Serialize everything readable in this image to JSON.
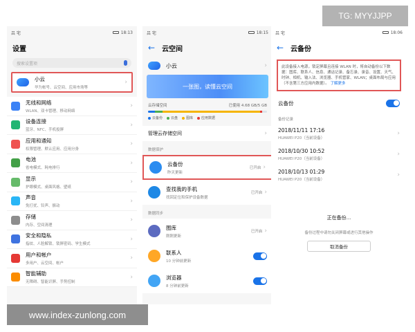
{
  "watermarks": {
    "top": "TG: MYYJJPP",
    "bottom": "www.index-zunlong.com"
  },
  "panel1": {
    "status": {
      "left": "吕 宅",
      "time": "18:13"
    },
    "title": "设置",
    "search_placeholder": "搜索设置项",
    "cloud_row": {
      "title": "小云",
      "subtitle": "华为帐号、云空间、应用市场等"
    },
    "items": [
      {
        "title": "无线和网络",
        "subtitle": "WLAN、双卡管理、移动网络",
        "color": "#3b82f6"
      },
      {
        "title": "设备连接",
        "subtitle": "蓝牙、NFC、手机投屏",
        "color": "#22b573"
      },
      {
        "title": "应用和通知",
        "subtitle": "权限管理、默认应用、应用分身",
        "color": "#ef5350"
      },
      {
        "title": "电池",
        "subtitle": "省电模式、耗电排行",
        "color": "#43a047"
      },
      {
        "title": "显示",
        "subtitle": "护眼模式、桌面风格、壁纸",
        "color": "#66bb6a"
      },
      {
        "title": "声音",
        "subtitle": "免打扰、铃声、振动",
        "color": "#29b6f6"
      },
      {
        "title": "存储",
        "subtitle": "内存、空间清理",
        "color": "#8d8d8d"
      },
      {
        "title": "安全和隐私",
        "subtitle": "指纹、人脸解锁、锁屏密码、学生模式",
        "color": "#3f73e0"
      },
      {
        "title": "用户和帐户",
        "subtitle": "多用户、云空间、帐户",
        "color": "#e53935"
      },
      {
        "title": "智能辅助",
        "subtitle": "无障碍、智能识屏、手势控制",
        "color": "#fb8c00"
      }
    ]
  },
  "panel2": {
    "status": {
      "left": "吕 宅",
      "time": "18:15"
    },
    "title": "云空间",
    "xiaoyun": "小云",
    "banner": "一张图，读懂云空间",
    "storage": {
      "label": "云存储空间",
      "usage": "已使用 4.68 GB/5 GB",
      "segments": [
        {
          "name": "云备份",
          "share": 0.06,
          "color": "#1a73e8"
        },
        {
          "name": "云盘",
          "share": 0.06,
          "color": "#4caf50"
        },
        {
          "name": "图库",
          "share": 0.82,
          "color": "#f5b400"
        },
        {
          "name": "应用数据",
          "share": 0.02,
          "color": "#e53935"
        }
      ]
    },
    "manage": "管理云存储空间",
    "section_protect": "数据保护",
    "protect": [
      {
        "title": "云备份",
        "subtitle": "昨天更新",
        "status": "已开启",
        "color": "#2b8cf0"
      },
      {
        "title": "查找我的手机",
        "subtitle": "找回定位和保护设备数据",
        "status": "已开启",
        "color": "#1e88e5"
      }
    ],
    "section_sync": "数据同步",
    "sync": [
      {
        "title": "图库",
        "subtitle": "刚刚更新",
        "status": "已开启",
        "color": "#5c6bc0"
      },
      {
        "title": "联系人",
        "subtitle": "10 分钟前更新",
        "status": "",
        "color": "#ffa726"
      },
      {
        "title": "浏览器",
        "subtitle": "8 分钟前更新",
        "status": "",
        "color": "#42a5f5"
      }
    ]
  },
  "panel3": {
    "status": {
      "left": "吕 宅",
      "time": "18:06"
    },
    "title": "云备份",
    "desc": "此设备接入电源，锁定屏幕且连接 WLAN 时，将自动备份以下数据：图库、联系人、信息、通话记录、备忘录、录音、设置、天气、时钟、相机、输入法、浏览器、手机管家、WLAN；桌面布局与应用（不含第三方应用内数据）。",
    "desc_link": "了解更多",
    "toggle_label": "云备份",
    "records_label": "备份记录",
    "records": [
      {
        "date": "2018/11/11 17:16",
        "device": "HUAWEI P20（当前设备）"
      },
      {
        "date": "2018/10/30 10:52",
        "device": "HUAWEI P20（当前设备）"
      },
      {
        "date": "2018/10/13 01:29",
        "device": "HUAWEI P20（当前设备）"
      }
    ],
    "backing_up": "正在备份...",
    "note": "备份过程中请勿关闭屏幕或进行其他操作",
    "cancel": "取消备份"
  }
}
